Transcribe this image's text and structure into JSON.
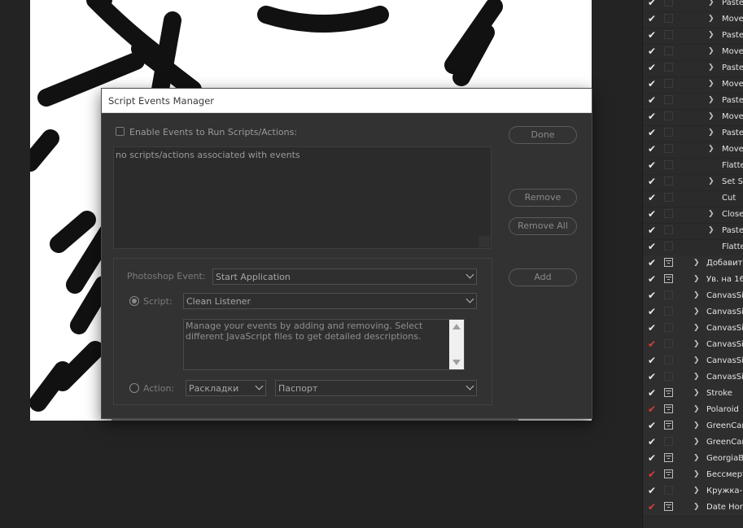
{
  "dialog": {
    "title": "Script Events Manager",
    "enable_label": "Enable Events to Run Scripts/Actions:",
    "enable_checked": false,
    "events_list_empty": "no scripts/actions associated with events",
    "buttons": {
      "done": "Done",
      "remove": "Remove",
      "remove_all": "Remove All",
      "add": "Add"
    },
    "photoshop_event_label": "Photoshop Event:",
    "photoshop_event_value": "Start Application",
    "script_label": "Script:",
    "script_value": "Clean Listener",
    "script_selected": true,
    "description": "Manage your events by adding and removing. Select different JavaScript files to get detailed descriptions.",
    "action_label": "Action:",
    "action_set_value": "Раскладки",
    "action_value": "Паспорт"
  },
  "actions_panel": {
    "rows": [
      {
        "check": "white",
        "dialog": "off",
        "expand": true,
        "indent": 2,
        "label": "Paste"
      },
      {
        "check": "white",
        "dialog": "off",
        "expand": true,
        "indent": 2,
        "label": "Move"
      },
      {
        "check": "white",
        "dialog": "off",
        "expand": true,
        "indent": 2,
        "label": "Paste"
      },
      {
        "check": "white",
        "dialog": "off",
        "expand": true,
        "indent": 2,
        "label": "Move"
      },
      {
        "check": "white",
        "dialog": "off",
        "expand": true,
        "indent": 2,
        "label": "Paste"
      },
      {
        "check": "white",
        "dialog": "off",
        "expand": true,
        "indent": 2,
        "label": "Move"
      },
      {
        "check": "white",
        "dialog": "off",
        "expand": true,
        "indent": 2,
        "label": "Paste"
      },
      {
        "check": "white",
        "dialog": "off",
        "expand": true,
        "indent": 2,
        "label": "Move"
      },
      {
        "check": "white",
        "dialog": "off",
        "expand": true,
        "indent": 2,
        "label": "Paste"
      },
      {
        "check": "white",
        "dialog": "off",
        "expand": true,
        "indent": 2,
        "label": "Move"
      },
      {
        "check": "white",
        "dialog": "off",
        "expand": false,
        "indent": 2,
        "label": "Flatten"
      },
      {
        "check": "white",
        "dialog": "off",
        "expand": true,
        "indent": 2,
        "label": "Set Se"
      },
      {
        "check": "white",
        "dialog": "off",
        "expand": false,
        "indent": 2,
        "label": "Cut"
      },
      {
        "check": "white",
        "dialog": "off",
        "expand": true,
        "indent": 2,
        "label": "Close"
      },
      {
        "check": "white",
        "dialog": "off",
        "expand": true,
        "indent": 2,
        "label": "Paste"
      },
      {
        "check": "white",
        "dialog": "off",
        "expand": false,
        "indent": 2,
        "label": "Flatten"
      },
      {
        "check": "white",
        "dialog": "on",
        "expand": true,
        "indent": 1,
        "label": "Добавить"
      },
      {
        "check": "white",
        "dialog": "on",
        "expand": true,
        "indent": 1,
        "label": "Ув. на 16"
      },
      {
        "check": "white",
        "dialog": "off",
        "expand": true,
        "indent": 1,
        "label": "CanvasSiz"
      },
      {
        "check": "white",
        "dialog": "off",
        "expand": true,
        "indent": 1,
        "label": "CanvasSiz"
      },
      {
        "check": "white",
        "dialog": "off",
        "expand": true,
        "indent": 1,
        "label": "CanvasSiz"
      },
      {
        "check": "red",
        "dialog": "off",
        "expand": true,
        "indent": 1,
        "label": "CanvasSiz"
      },
      {
        "check": "white",
        "dialog": "off",
        "expand": true,
        "indent": 1,
        "label": "CanvasSiz"
      },
      {
        "check": "white",
        "dialog": "off",
        "expand": true,
        "indent": 1,
        "label": "CanvasSiz"
      },
      {
        "check": "white",
        "dialog": "on",
        "expand": true,
        "indent": 1,
        "label": "Stroke"
      },
      {
        "check": "red",
        "dialog": "on",
        "expand": true,
        "indent": 1,
        "label": "Polaroid"
      },
      {
        "check": "white",
        "dialog": "on",
        "expand": true,
        "indent": 1,
        "label": "GreenCard"
      },
      {
        "check": "white",
        "dialog": "off",
        "expand": true,
        "indent": 1,
        "label": "GreenCard"
      },
      {
        "check": "white",
        "dialog": "on",
        "expand": true,
        "indent": 1,
        "label": "GeorgiaBa"
      },
      {
        "check": "red",
        "dialog": "on",
        "expand": true,
        "indent": 1,
        "label": "Бессмерт"
      },
      {
        "check": "white",
        "dialog": "off",
        "expand": true,
        "indent": 1,
        "label": "Кружка-В"
      },
      {
        "check": "red",
        "dialog": "on",
        "expand": true,
        "indent": 1,
        "label": "Date Hor/V"
      }
    ]
  },
  "colors": {
    "app_bg": "#232323",
    "panel_bg": "#2b2b2b",
    "dialog_bg": "#323232",
    "check_red": "#e23b3b"
  }
}
